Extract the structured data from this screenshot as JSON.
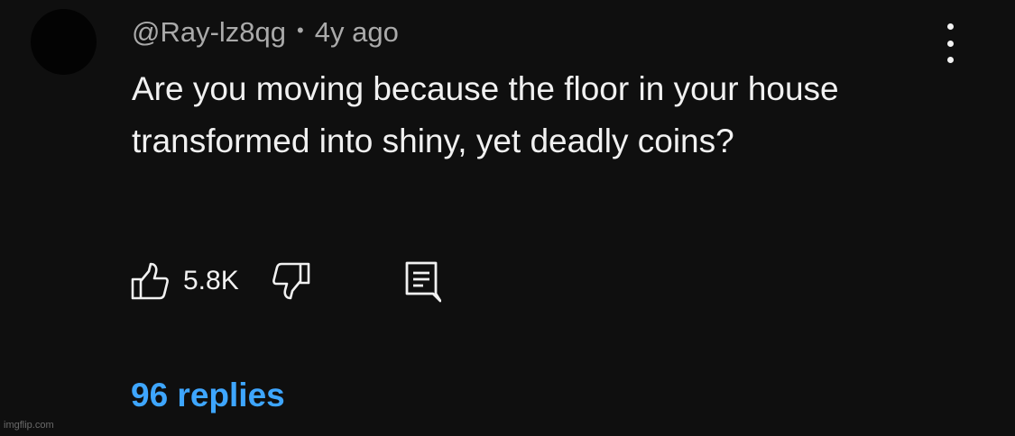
{
  "comment": {
    "author": "@Ray-lz8qg",
    "separator": "•",
    "time_ago": "4y ago",
    "text": "Are you moving because the floor in your house transformed into shiny, yet deadly coins?"
  },
  "actions": {
    "like_count": "5.8K",
    "like_icon": "thumbs-up-icon",
    "dislike_icon": "thumbs-down-icon",
    "reply_icon": "reply-icon",
    "menu_icon": "more-vert-icon"
  },
  "replies": {
    "label": "96 replies"
  },
  "watermark": "imgflip.com",
  "colors": {
    "background": "#0f0f0f",
    "text": "#f1f1f1",
    "secondary_text": "#aaaaaa",
    "link": "#3ea6ff"
  }
}
